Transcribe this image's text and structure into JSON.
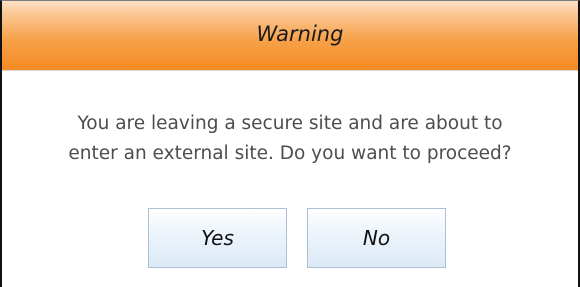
{
  "dialog": {
    "title": "Warning",
    "message_line1": "You are leaving a secure site and are about to",
    "message_line2": "enter an external site. Do you want to proceed?",
    "buttons": {
      "yes_label": "Yes",
      "no_label": "No"
    }
  },
  "colors": {
    "titlebar_accent": "#f48a22",
    "button_fill": "#dbe9f6",
    "message_text": "#4d4d4d"
  }
}
